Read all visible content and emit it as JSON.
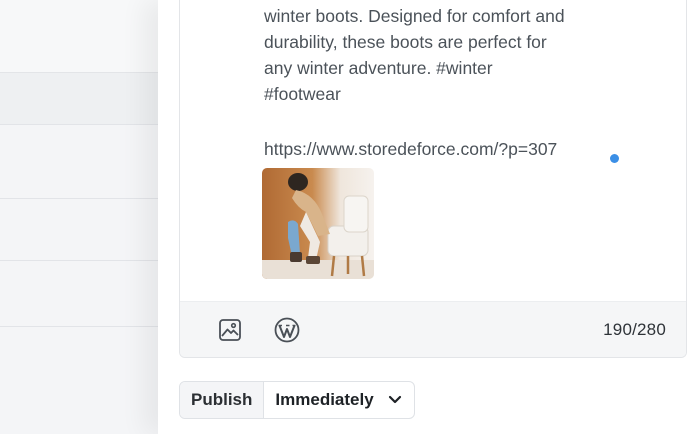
{
  "post": {
    "text_lines": [
      "winter boots. Designed for comfort and",
      "durability, these boots are perfect for",
      "any winter adventure. #winter",
      "#footwear"
    ],
    "link": "https://www.storedeforce.com/?p=307",
    "image_alt": "Person trying on boots"
  },
  "toolbar": {
    "image_icon": "image-icon",
    "wordpress_icon": "wordpress-icon",
    "char_count": "190/280"
  },
  "publish": {
    "button_label": "Publish",
    "schedule_value": "Immediately",
    "dropdown_icon": "chevron-down-icon"
  },
  "colors": {
    "accent_dot": "#3b8fe6",
    "text": "#4b5259"
  }
}
